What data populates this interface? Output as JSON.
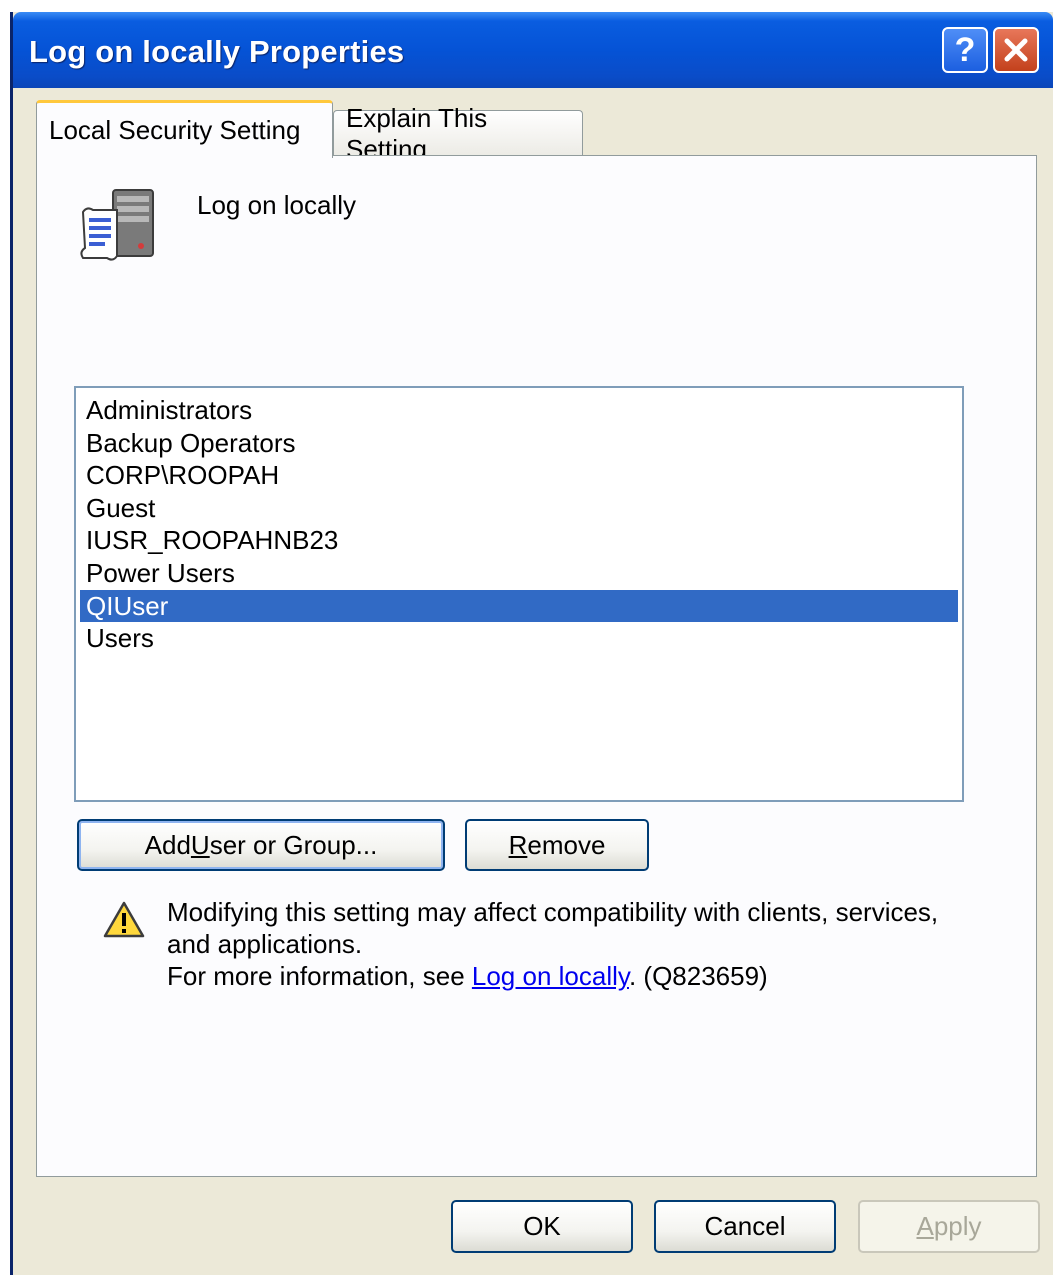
{
  "window": {
    "title": "Log on locally Properties",
    "help_glyph": "?",
    "colors": {
      "titlebar": "#0553d6",
      "selection": "#316ac5",
      "link": "#0000ee"
    }
  },
  "tabs": [
    {
      "label": "Local Security Setting",
      "active": true
    },
    {
      "label": "Explain This Setting",
      "active": false
    }
  ],
  "policy": {
    "icon": "security-policy-icon",
    "name": "Log on locally"
  },
  "list": {
    "items": [
      "Administrators",
      "Backup Operators",
      "CORP\\ROOPAH",
      "Guest",
      "IUSR_ROOPAHNB23",
      "Power Users",
      "QIUser",
      "Users"
    ],
    "selected": "QIUser"
  },
  "buttons": {
    "add": {
      "pre": "Add ",
      "mnemonic": "U",
      "post": "ser or Group..."
    },
    "remove": {
      "mnemonic": "R",
      "post": "emove"
    },
    "ok": "OK",
    "cancel": "Cancel",
    "apply": {
      "mnemonic": "A",
      "post": "pply"
    }
  },
  "warning": {
    "icon": "warning-icon",
    "line1": "Modifying this setting may affect compatibility with clients, services,",
    "line2": "and applications.",
    "line3_prefix": "For more information, see ",
    "link_text": "Log on locally",
    "line3_suffix": ". (Q823659)"
  }
}
